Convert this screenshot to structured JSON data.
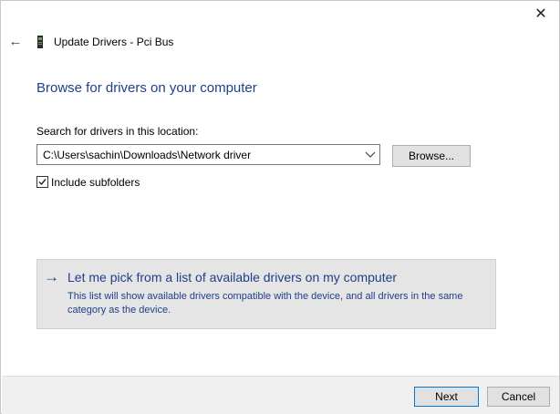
{
  "window": {
    "title": "Update Drivers - Pci Bus",
    "close_glyph": "✕",
    "back_glyph": "←"
  },
  "page": {
    "heading": "Browse for drivers on your computer",
    "search_label": "Search for drivers in this location:",
    "path_value": "C:\\Users\\sachin\\Downloads\\Network driver",
    "browse_label": "Browse...",
    "include_subfolders_label": "Include subfolders",
    "include_subfolders_checked": true
  },
  "pick_option": {
    "arrow_glyph": "→",
    "title": "Let me pick from a list of available drivers on my computer",
    "description": "This list will show available drivers compatible with the device, and all drivers in the same category as the device."
  },
  "footer": {
    "next_label": "Next",
    "cancel_label": "Cancel"
  },
  "colors": {
    "accent_text": "#1f3f8a",
    "focus_border": "#0078d7"
  },
  "icons": {
    "close": "close-icon",
    "back": "back-arrow-icon",
    "device": "device-icon",
    "dropdown": "chevron-down-icon",
    "check": "checkmark-icon",
    "pick": "arrow-right-icon"
  }
}
